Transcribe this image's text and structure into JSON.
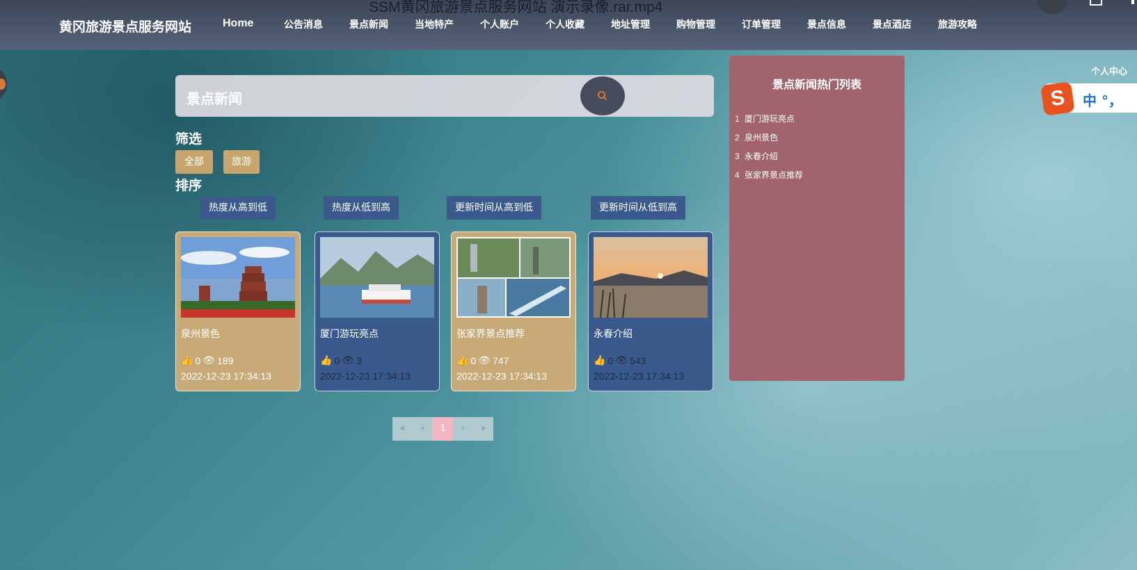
{
  "video_title": "SSM黄冈旅游景点服务网站 演示录像.rar.mp4",
  "brand": "黄冈旅游景点服务网站",
  "nav": [
    "Home",
    "公告消息",
    "景点新闻",
    "当地特产",
    "个人账户",
    "个人收藏",
    "地址管理",
    "购物管理",
    "订单管理",
    "景点信息",
    "景点酒店",
    "旅游攻略"
  ],
  "search": {
    "label": "景点新闻"
  },
  "filter": {
    "title": "筛选",
    "options": [
      "全部",
      "旅游"
    ]
  },
  "sort": {
    "title": "排序",
    "options": [
      "热度从高到低",
      "热度从低到高",
      "更新时间从高到低",
      "更新时间从低到高"
    ]
  },
  "cards": [
    {
      "title": "泉州景色",
      "likes": "0",
      "views": "189",
      "date": "2022-12-23 17:34:13",
      "style": "gold"
    },
    {
      "title": "厦门游玩亮点",
      "likes": "0",
      "views": "3",
      "date": "2022-12-23 17:34:13",
      "style": "blue"
    },
    {
      "title": "张家界景点推荐",
      "likes": "0",
      "views": "747",
      "date": "2022-12-23 17:34:13",
      "style": "gold"
    },
    {
      "title": "永春介绍",
      "likes": "0",
      "views": "543",
      "date": "2022-12-23 17:34:13",
      "style": "blue"
    }
  ],
  "hot": {
    "title": "景点新闻热门列表",
    "items": [
      {
        "num": "1",
        "label": "厦门游玩亮点"
      },
      {
        "num": "2",
        "label": "泉州景色"
      },
      {
        "num": "3",
        "label": "永春介绍"
      },
      {
        "num": "4",
        "label": "张家界景点推荐"
      }
    ]
  },
  "user_center": "个人中心",
  "ime": {
    "logo": "S",
    "text": "中 °，"
  },
  "pager": {
    "first": "«",
    "prev": "‹",
    "current": "1",
    "next": "›",
    "last": "»"
  },
  "colors": {
    "navbar": "#4a5468",
    "gold_card": "#c8aa78",
    "blue_card": "#3a5a8e",
    "hot_panel": "#a1646e",
    "sort_btn": "#3b5a8c",
    "chip": "#c8a46e",
    "pager_active": "#f4b6c2"
  }
}
